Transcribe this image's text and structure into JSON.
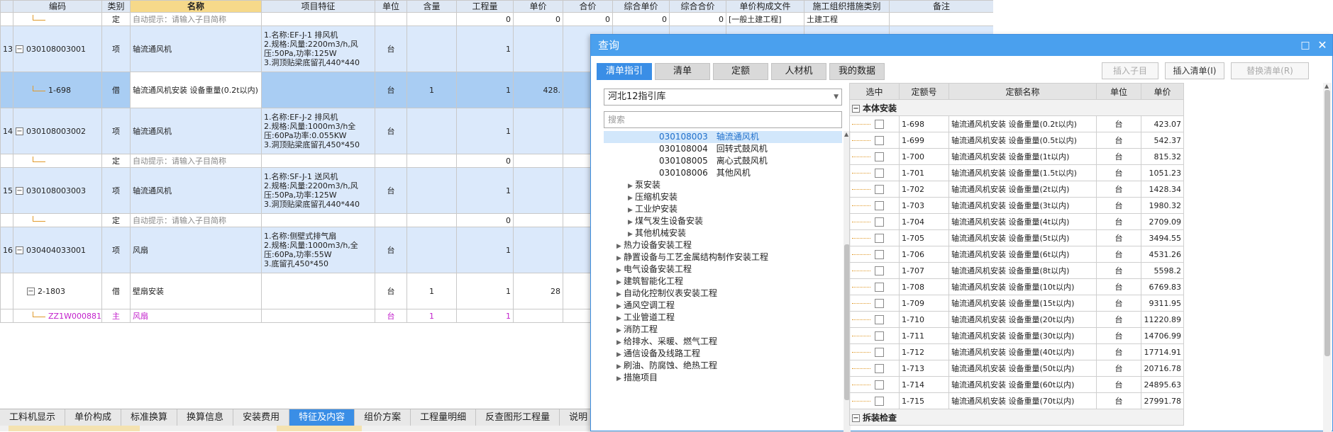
{
  "bill": {
    "headers": [
      "编码",
      "类别",
      "名称",
      "项目特征",
      "单位",
      "含量",
      "工程量",
      "单价",
      "合价",
      "综合单价",
      "综合合价",
      "单价构成文件",
      "施工组织措施类别",
      "备注"
    ],
    "highlight_header": "名称",
    "rows": [
      {
        "kind": "sub",
        "num": "",
        "code": "",
        "type": "定",
        "name": "自动提示：请输入子目简称",
        "feat": "",
        "unit": "",
        "cont": "",
        "qty": "0",
        "price": "0",
        "total": "0",
        "uprice": "0",
        "utotal": "0",
        "file": "[一般土建工程]",
        "cat": "土建工程",
        "note": ""
      },
      {
        "kind": "item",
        "num": "13",
        "code": "030108003001",
        "type": "项",
        "name": "轴流通风机",
        "feat": [
          "1.名称:EF-J-1 排风机",
          "2.规格:风量:2200m3/h,风压:50Pa,功率:125W",
          "3.洞顶贴梁底留孔440*440"
        ],
        "unit": "台",
        "cont": "",
        "qty": "1",
        "price": "",
        "total": "",
        "uprice": "",
        "utotal": "",
        "file": "",
        "cat": "",
        "note": ""
      },
      {
        "kind": "sel",
        "num": "",
        "code": "1-698",
        "type": "借",
        "name": "轴流通风机安装 设备重量(0.2t以内)",
        "feat": "",
        "unit": "台",
        "cont": "1",
        "qty": "1",
        "price": "428.",
        "total": "",
        "uprice": "",
        "utotal": "",
        "file": "",
        "cat": "",
        "note": ""
      },
      {
        "kind": "item",
        "num": "14",
        "code": "030108003002",
        "type": "项",
        "name": "轴流通风机",
        "feat": [
          "1.名称:EF-J-2 排风机",
          "2.规格:风量:1000m3/h全压:60Pa功率:0.055KW",
          "3.洞顶贴梁底留孔450*450"
        ],
        "unit": "台",
        "cont": "",
        "qty": "1",
        "price": "",
        "total": "",
        "uprice": "",
        "utotal": "",
        "file": "",
        "cat": "",
        "note": ""
      },
      {
        "kind": "sub",
        "num": "",
        "code": "",
        "type": "定",
        "name": "自动提示：请输入子目简称",
        "feat": "",
        "unit": "",
        "cont": "",
        "qty": "0",
        "price": "",
        "total": "",
        "uprice": "",
        "utotal": "",
        "file": "",
        "cat": "",
        "note": ""
      },
      {
        "kind": "item",
        "num": "15",
        "code": "030108003003",
        "type": "项",
        "name": "轴流通风机",
        "feat": [
          "1.名称:SF-J-1 送风机",
          "2.规格:风量:2200m3/h,风压:50Pa,功率:125W",
          "3.洞顶贴梁底留孔440*440"
        ],
        "unit": "台",
        "cont": "",
        "qty": "1",
        "price": "",
        "total": "",
        "uprice": "",
        "utotal": "",
        "file": "",
        "cat": "",
        "note": ""
      },
      {
        "kind": "sub",
        "num": "",
        "code": "",
        "type": "定",
        "name": "自动提示：请输入子目简称",
        "feat": "",
        "unit": "",
        "cont": "",
        "qty": "0",
        "price": "",
        "total": "",
        "uprice": "",
        "utotal": "",
        "file": "",
        "cat": "",
        "note": ""
      },
      {
        "kind": "item",
        "num": "16",
        "code": "030404033001",
        "type": "项",
        "name": "风扇",
        "feat": [
          "1.名称:侧壁式排气扇",
          "2.规格:风量:1000m3/h,全压:60Pa,功率:55W",
          "3.底留孔450*450"
        ],
        "unit": "台",
        "cont": "",
        "qty": "1",
        "price": "",
        "total": "",
        "uprice": "",
        "utotal": "",
        "file": "",
        "cat": "",
        "note": ""
      },
      {
        "kind": "child",
        "num": "",
        "code": "2-1803",
        "type": "借",
        "name": "壁扇安装",
        "feat": "",
        "unit": "台",
        "cont": "1",
        "qty": "1",
        "price": "28",
        "total": "",
        "uprice": "",
        "utotal": "",
        "file": "",
        "cat": "",
        "note": ""
      },
      {
        "kind": "main",
        "num": "",
        "code": "ZZ1W000881",
        "type": "主",
        "name": "风扇",
        "feat": "",
        "unit": "台",
        "cont": "1",
        "qty": "1",
        "price": "",
        "total": "",
        "uprice": "",
        "utotal": "",
        "file": "",
        "cat": "",
        "note": ""
      }
    ]
  },
  "bottom_tabs": [
    "工料机显示",
    "单价构成",
    "标准换算",
    "换算信息",
    "安装费用",
    "特征及内容",
    "组价方案",
    "工程量明细",
    "反查图形工程量",
    "说明"
  ],
  "bottom_active": "特征及内容",
  "dialog": {
    "title": "查询",
    "tabs": [
      "清单指引",
      "清单",
      "定额",
      "人材机",
      "我的数据"
    ],
    "active_tab": "清单指引",
    "btn_insert_sub": "插入子目",
    "btn_insert_list": "插入清单(I)",
    "btn_replace_list": "替换清单(R)",
    "library": "河北12指引库",
    "search_placeholder": "搜索",
    "tree": [
      {
        "level": 3,
        "code": "030108003",
        "name": "轴流通风机",
        "sel": true,
        "arrow": false
      },
      {
        "level": 3,
        "code": "030108004",
        "name": "回转式鼓风机",
        "sel": false,
        "arrow": false
      },
      {
        "level": 3,
        "code": "030108005",
        "name": "离心式鼓风机",
        "sel": false,
        "arrow": false
      },
      {
        "level": 3,
        "code": "030108006",
        "name": "其他风机",
        "sel": false,
        "arrow": false
      },
      {
        "level": 2,
        "code": "",
        "name": "泵安装",
        "sel": false,
        "arrow": true
      },
      {
        "level": 2,
        "code": "",
        "name": "压缩机安装",
        "sel": false,
        "arrow": true
      },
      {
        "level": 2,
        "code": "",
        "name": "工业炉安装",
        "sel": false,
        "arrow": true
      },
      {
        "level": 2,
        "code": "",
        "name": "煤气发生设备安装",
        "sel": false,
        "arrow": true
      },
      {
        "level": 2,
        "code": "",
        "name": "其他机械安装",
        "sel": false,
        "arrow": true
      },
      {
        "level": 1,
        "code": "",
        "name": "热力设备安装工程",
        "sel": false,
        "arrow": true
      },
      {
        "level": 1,
        "code": "",
        "name": "静置设备与工艺金属结构制作安装工程",
        "sel": false,
        "arrow": true
      },
      {
        "level": 1,
        "code": "",
        "name": "电气设备安装工程",
        "sel": false,
        "arrow": true
      },
      {
        "level": 1,
        "code": "",
        "name": "建筑智能化工程",
        "sel": false,
        "arrow": true
      },
      {
        "level": 1,
        "code": "",
        "name": "自动化控制仪表安装工程",
        "sel": false,
        "arrow": true
      },
      {
        "level": 1,
        "code": "",
        "name": "通风空调工程",
        "sel": false,
        "arrow": true
      },
      {
        "level": 1,
        "code": "",
        "name": "工业管道工程",
        "sel": false,
        "arrow": true
      },
      {
        "level": 1,
        "code": "",
        "name": "消防工程",
        "sel": false,
        "arrow": true
      },
      {
        "level": 1,
        "code": "",
        "name": "给排水、采暖、燃气工程",
        "sel": false,
        "arrow": true
      },
      {
        "level": 1,
        "code": "",
        "name": "通信设备及线路工程",
        "sel": false,
        "arrow": true
      },
      {
        "level": 1,
        "code": "",
        "name": "刷油、防腐蚀、绝热工程",
        "sel": false,
        "arrow": true
      },
      {
        "level": 1,
        "code": "",
        "name": "措施项目",
        "sel": false,
        "arrow": true
      }
    ],
    "quota_headers": [
      "选中",
      "定额号",
      "定额名称",
      "单位",
      "单价"
    ],
    "group1": "本体安装",
    "group2": "拆装检查",
    "quota_rows": [
      {
        "code": "1-698",
        "name": "轴流通风机安装 设备重量(0.2t以内)",
        "unit": "台",
        "price": "423.07"
      },
      {
        "code": "1-699",
        "name": "轴流通风机安装 设备重量(0.5t以内)",
        "unit": "台",
        "price": "542.37"
      },
      {
        "code": "1-700",
        "name": "轴流通风机安装 设备重量(1t以内)",
        "unit": "台",
        "price": "815.32"
      },
      {
        "code": "1-701",
        "name": "轴流通风机安装 设备重量(1.5t以内)",
        "unit": "台",
        "price": "1051.23"
      },
      {
        "code": "1-702",
        "name": "轴流通风机安装 设备重量(2t以内)",
        "unit": "台",
        "price": "1428.34"
      },
      {
        "code": "1-703",
        "name": "轴流通风机安装 设备重量(3t以内)",
        "unit": "台",
        "price": "1980.32"
      },
      {
        "code": "1-704",
        "name": "轴流通风机安装 设备重量(4t以内)",
        "unit": "台",
        "price": "2709.09"
      },
      {
        "code": "1-705",
        "name": "轴流通风机安装 设备重量(5t以内)",
        "unit": "台",
        "price": "3494.55"
      },
      {
        "code": "1-706",
        "name": "轴流通风机安装 设备重量(6t以内)",
        "unit": "台",
        "price": "4531.26"
      },
      {
        "code": "1-707",
        "name": "轴流通风机安装 设备重量(8t以内)",
        "unit": "台",
        "price": "5598.2"
      },
      {
        "code": "1-708",
        "name": "轴流通风机安装 设备重量(10t以内)",
        "unit": "台",
        "price": "6769.83"
      },
      {
        "code": "1-709",
        "name": "轴流通风机安装 设备重量(15t以内)",
        "unit": "台",
        "price": "9311.95"
      },
      {
        "code": "1-710",
        "name": "轴流通风机安装 设备重量(20t以内)",
        "unit": "台",
        "price": "11220.89"
      },
      {
        "code": "1-711",
        "name": "轴流通风机安装 设备重量(30t以内)",
        "unit": "台",
        "price": "14706.99"
      },
      {
        "code": "1-712",
        "name": "轴流通风机安装 设备重量(40t以内)",
        "unit": "台",
        "price": "17714.91"
      },
      {
        "code": "1-713",
        "name": "轴流通风机安装 设备重量(50t以内)",
        "unit": "台",
        "price": "20716.78"
      },
      {
        "code": "1-714",
        "name": "轴流通风机安装 设备重量(60t以内)",
        "unit": "台",
        "price": "24895.63"
      },
      {
        "code": "1-715",
        "name": "轴流通风机安装 设备重量(70t以内)",
        "unit": "台",
        "price": "27991.78"
      }
    ]
  },
  "colors": {
    "accent": "#3a8ee6",
    "title_bar": "#4aa0ee",
    "item_row": "#dbe9fb",
    "selected_row": "#a9cdf3",
    "main_material": "#c21fcb"
  }
}
